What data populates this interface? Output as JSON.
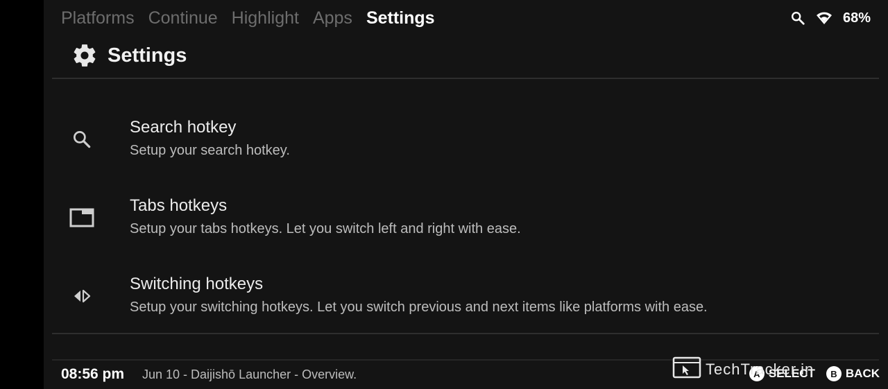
{
  "tabs": [
    {
      "label": "Platforms",
      "active": false
    },
    {
      "label": "Continue",
      "active": false
    },
    {
      "label": "Highlight",
      "active": false
    },
    {
      "label": "Apps",
      "active": false
    },
    {
      "label": "Settings",
      "active": true
    }
  ],
  "status": {
    "battery": "68%",
    "icons": [
      "search-icon",
      "wifi-icon"
    ]
  },
  "header": {
    "title": "Settings",
    "icon": "gear-icon"
  },
  "items": [
    {
      "icon": "search-icon",
      "title": "Search hotkey",
      "desc": "Setup your search hotkey."
    },
    {
      "icon": "tab-window-icon",
      "title": "Tabs hotkeys",
      "desc": "Setup your tabs hotkeys. Let you switch left and right with ease."
    },
    {
      "icon": "switch-arrows-icon",
      "title": "Switching hotkeys",
      "desc": "Setup your switching hotkeys. Let you switch previous and next items like platforms with ease."
    }
  ],
  "footer": {
    "time": "08:56 pm",
    "info": "Jun 10 - Daijishō Launcher - Overview.",
    "hints": [
      {
        "button": "A",
        "label": "SELECT"
      },
      {
        "button": "B",
        "label": "BACK"
      }
    ]
  },
  "watermark": {
    "text": "TechTracker.in"
  },
  "colors": {
    "background": "#141414",
    "text_primary": "#ececec",
    "text_secondary": "#bdbdbd",
    "tab_inactive": "#6d6d6d"
  }
}
